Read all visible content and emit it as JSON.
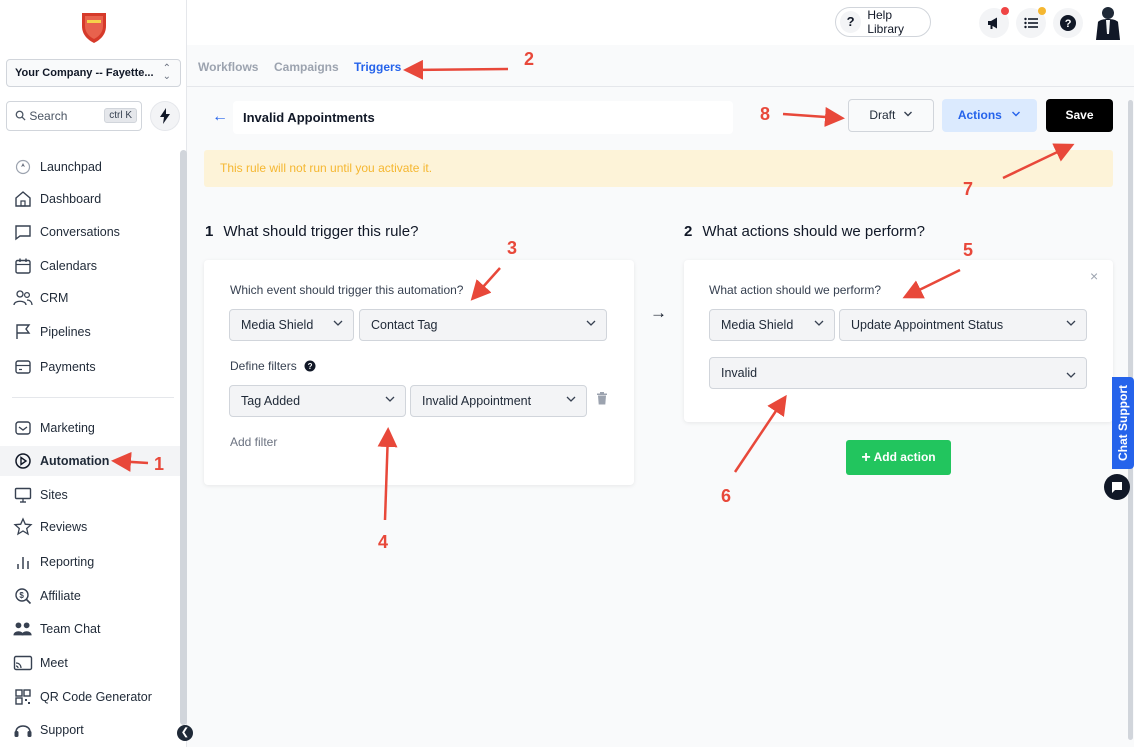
{
  "sidebar": {
    "company": "Your Company -- Fayette...",
    "search_label": "Search",
    "search_shortcut": "ctrl K",
    "items": [
      {
        "label": "Launchpad",
        "icon": "launchpad-icon"
      },
      {
        "label": "Dashboard",
        "icon": "dashboard-icon"
      },
      {
        "label": "Conversations",
        "icon": "conversations-icon"
      },
      {
        "label": "Calendars",
        "icon": "calendar-icon"
      },
      {
        "label": "CRM",
        "icon": "crm-icon"
      },
      {
        "label": "Pipelines",
        "icon": "pipelines-icon"
      },
      {
        "label": "Payments",
        "icon": "payments-icon"
      },
      {
        "label": "Marketing",
        "icon": "marketing-icon"
      },
      {
        "label": "Automation",
        "icon": "automation-icon",
        "active": true
      },
      {
        "label": "Sites",
        "icon": "sites-icon"
      },
      {
        "label": "Reviews",
        "icon": "reviews-icon"
      },
      {
        "label": "Reporting",
        "icon": "reporting-icon"
      },
      {
        "label": "Affiliate",
        "icon": "affiliate-icon"
      },
      {
        "label": "Team Chat",
        "icon": "team-chat-icon"
      },
      {
        "label": "Meet",
        "icon": "meet-icon"
      },
      {
        "label": "QR Code Generator",
        "icon": "qr-code-icon"
      },
      {
        "label": "Support",
        "icon": "support-icon"
      }
    ]
  },
  "topbar": {
    "help_label": "Help Library"
  },
  "subnav": {
    "tabs": [
      "Workflows",
      "Campaigns",
      "Triggers"
    ],
    "active": "Triggers"
  },
  "header": {
    "title": "Invalid Appointments",
    "status": "Draft",
    "actions_label": "Actions",
    "save_label": "Save"
  },
  "banner": "This rule will not run until you activate it.",
  "trigger": {
    "number": "1",
    "title": "What should trigger this rule?",
    "question": "Which event should trigger this automation?",
    "source": "Media Shield",
    "event": "Contact Tag",
    "filters_label": "Define filters",
    "filter_field": "Tag Added",
    "filter_value": "Invalid Appointment",
    "add_filter": "Add filter"
  },
  "action": {
    "number": "2",
    "title": "What actions should we perform?",
    "question": "What action should we perform?",
    "source": "Media Shield",
    "action": "Update Appointment Status",
    "status": "Invalid",
    "add_action": "Add action"
  },
  "chat_support": "Chat Support",
  "annotations": [
    "1",
    "2",
    "3",
    "4",
    "5",
    "6",
    "7",
    "8"
  ],
  "colors": {
    "accent": "#2563eb",
    "annotation": "#e8483a",
    "add_action": "#22c55e",
    "banner_text": "#f5b731"
  }
}
